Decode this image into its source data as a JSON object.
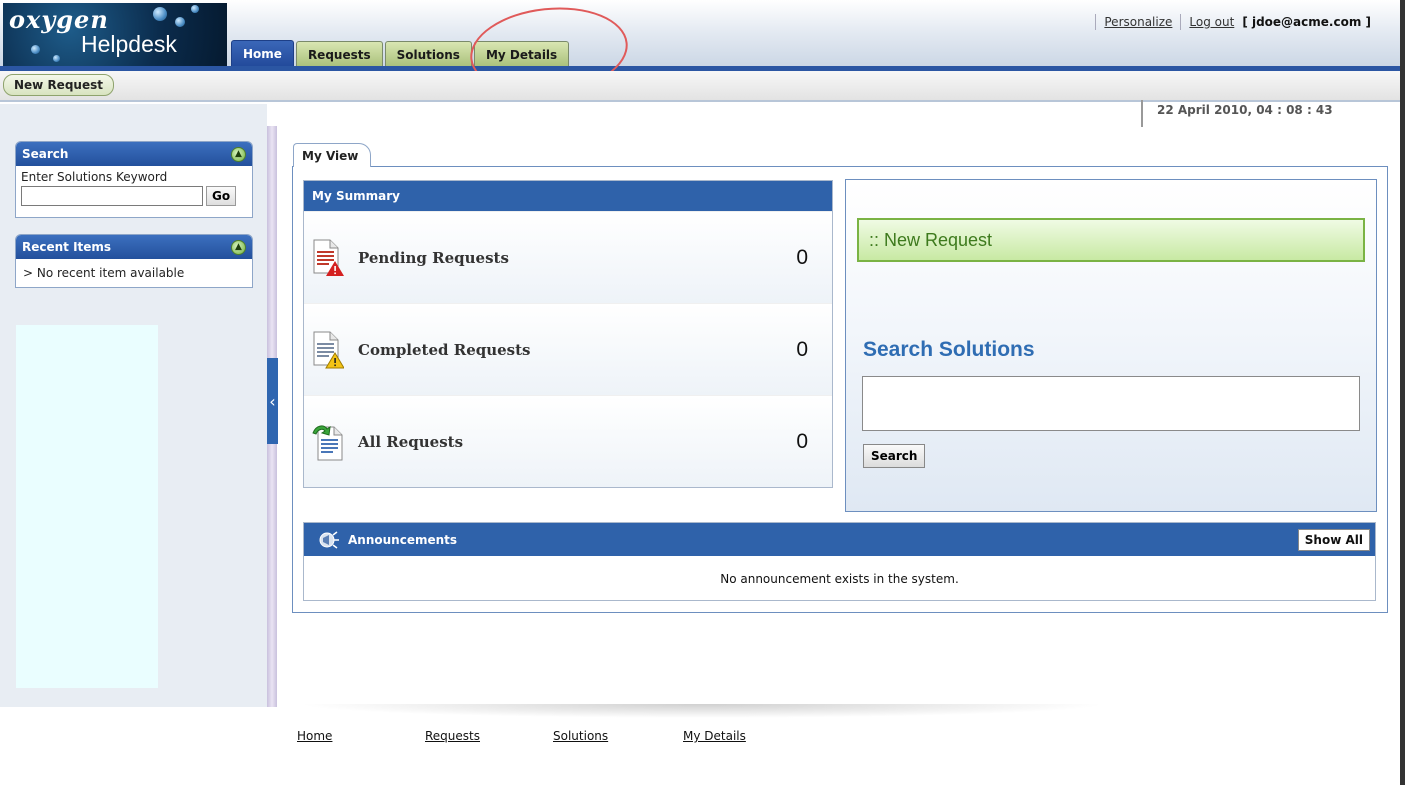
{
  "header": {
    "logo_brand": "oxygen",
    "logo_product": "Helpdesk",
    "tabs": [
      {
        "label": "Home",
        "active": true
      },
      {
        "label": "Requests",
        "active": false
      },
      {
        "label": "Solutions",
        "active": false
      },
      {
        "label": "My Details",
        "active": false
      }
    ],
    "links": {
      "personalize": "Personalize",
      "logout": "Log out",
      "user": "[ jdoe@acme.com ]"
    }
  },
  "subbar": {
    "new_request_label": "New Request",
    "datetime": "22 April 2010, 04 : 08 : 43"
  },
  "sidebar": {
    "search": {
      "title": "Search",
      "label": "Enter Solutions Keyword",
      "value": "",
      "go_label": "Go"
    },
    "recent": {
      "title": "Recent Items",
      "empty_text": ">  No recent item available"
    }
  },
  "main": {
    "view_tab": "My View",
    "summary": {
      "title": "My Summary",
      "rows": [
        {
          "label": "Pending Requests",
          "count": "0",
          "icon": "pending-request-icon"
        },
        {
          "label": "Completed Requests",
          "count": "0",
          "icon": "completed-request-icon"
        },
        {
          "label": "All Requests",
          "count": "0",
          "icon": "all-requests-icon"
        }
      ]
    },
    "quick": {
      "new_request": ":: New Request",
      "search_title": "Search Solutions",
      "search_value": "",
      "search_button": "Search"
    },
    "announcements": {
      "title": "Announcements",
      "show_all": "Show All",
      "empty_text": "No announcement exists in the system."
    }
  },
  "footer": {
    "links": [
      "Home",
      "Requests",
      "Solutions",
      "My Details"
    ]
  },
  "colors": {
    "nav_blue": "#2b56a3",
    "tab_green": "#a9c07a",
    "banner_green": "#3d7a1d",
    "search_title_blue": "#2f6db3",
    "annotation_red": "#e05a5a"
  }
}
